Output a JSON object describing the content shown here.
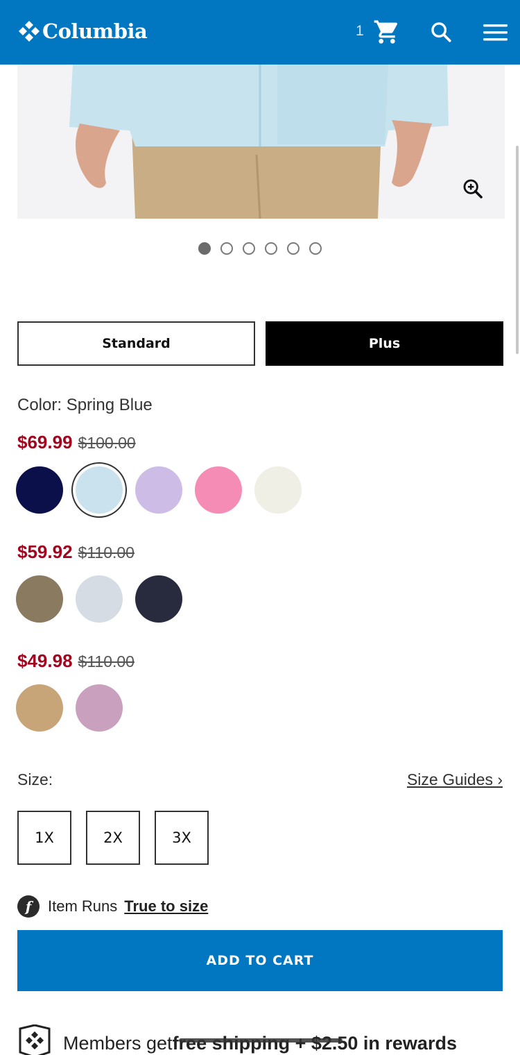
{
  "header": {
    "brand": "Columbia",
    "cart_count": "1",
    "bg_color": "#0077c0"
  },
  "gallery": {
    "image_count": 6,
    "active_index": 0
  },
  "fit_options": {
    "standard": "Standard",
    "plus": "Plus",
    "selected": "Plus"
  },
  "color": {
    "label": "Color: Spring Blue",
    "groups": [
      {
        "sale_price": "$69.99",
        "original_price": "$100.00",
        "swatches": [
          "#0b0f4a",
          "#c9e2ee",
          "#cdbde6",
          "#f58cb6",
          "#f0efe6"
        ],
        "selected_index": 1
      },
      {
        "sale_price": "$59.92",
        "original_price": "$110.00",
        "swatches": [
          "#8a7a60",
          "#d6dce3",
          "#282b3e"
        ]
      },
      {
        "sale_price": "$49.98",
        "original_price": "$110.00",
        "swatches": [
          "#c8a479",
          "#c9a0bd"
        ]
      }
    ]
  },
  "size": {
    "label": "Size:",
    "guide_link": "Size Guides ›",
    "options": [
      "1X",
      "2X",
      "3X"
    ]
  },
  "fit_note": {
    "badge": "f",
    "text": "Item Runs",
    "value": "True to size"
  },
  "add_to_cart": "ADD TO CART",
  "members": {
    "text_regular": "Members get ",
    "text_bold": "free shipping + $2.50 in rewards"
  }
}
